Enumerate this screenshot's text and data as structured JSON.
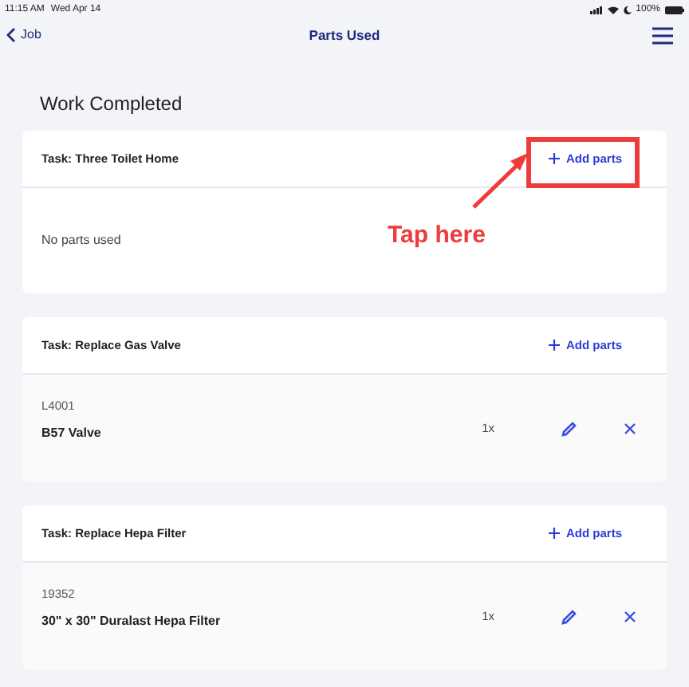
{
  "status_bar": {
    "time": "11:15 AM",
    "date": "Wed Apr 14",
    "battery": "100%"
  },
  "nav": {
    "back": "Job",
    "title": "Parts Used"
  },
  "heading": "Work Completed",
  "tasks": [
    {
      "title": "Task: Three Toilet Home",
      "add": "Add parts",
      "empty": "No parts used"
    },
    {
      "title": "Task: Replace Gas Valve",
      "add": "Add parts",
      "parts": [
        {
          "code": "L4001",
          "name": "B57 Valve",
          "qty": "1x"
        }
      ]
    },
    {
      "title": "Task: Replace Hepa Filter",
      "add": "Add parts",
      "parts": [
        {
          "code": "19352",
          "name": "30\" x 30\" Duralast Hepa Filter",
          "qty": "1x"
        }
      ]
    }
  ],
  "annotation": {
    "text": "Tap here"
  }
}
